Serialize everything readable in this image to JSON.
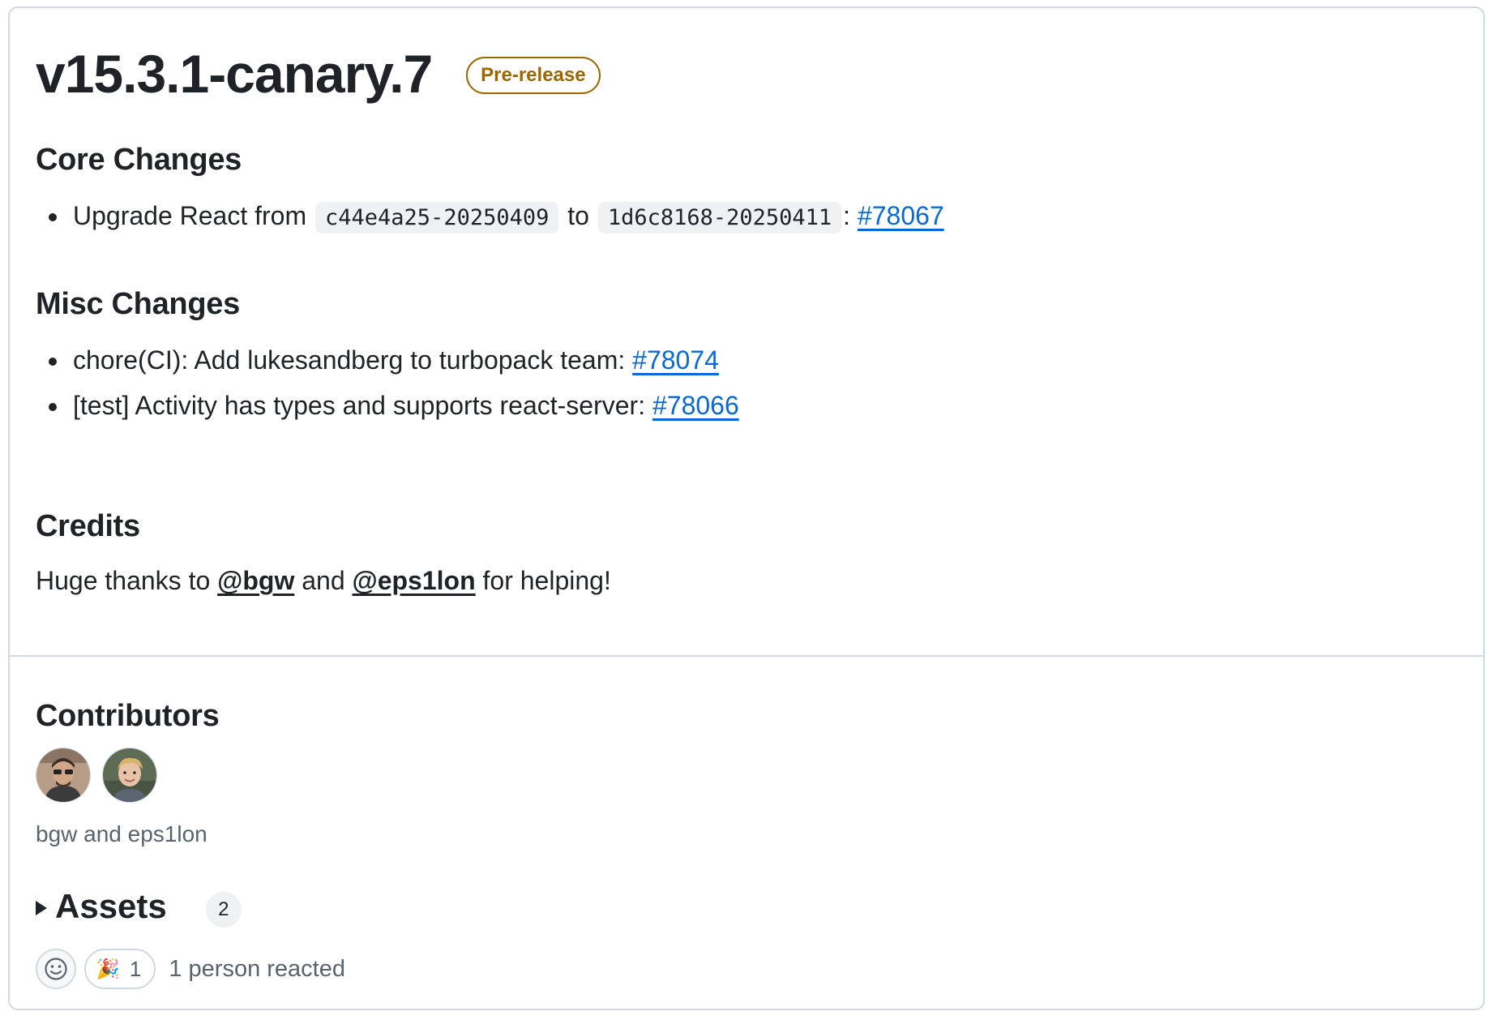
{
  "release": {
    "tag": "v15.3.1-canary.7",
    "badge": "Pre-release"
  },
  "sections": {
    "core": {
      "heading": "Core Changes",
      "items": [
        {
          "prefix": "Upgrade React from",
          "code_from": "c44e4a25-20250409",
          "middle": "to",
          "code_to": "1d6c8168-20250411",
          "separator": ":",
          "link": "#78067"
        }
      ]
    },
    "misc": {
      "heading": "Misc Changes",
      "items": [
        {
          "text": "chore(CI): Add lukesandberg to turbopack team:",
          "link": "#78074"
        },
        {
          "text": "[test] Activity has types and supports react-server:",
          "link": "#78066"
        }
      ]
    },
    "credits": {
      "heading": "Credits",
      "prefix": "Huge thanks to",
      "mention1": "@bgw",
      "and": "and",
      "mention2": "@eps1lon",
      "suffix": "for helping!"
    }
  },
  "contributors": {
    "heading": "Contributors",
    "names": "bgw and eps1lon"
  },
  "assets": {
    "label": "Assets",
    "count": "2"
  },
  "reactions": {
    "emoji": "🎉",
    "count": "1",
    "summary": "1 person reacted"
  }
}
